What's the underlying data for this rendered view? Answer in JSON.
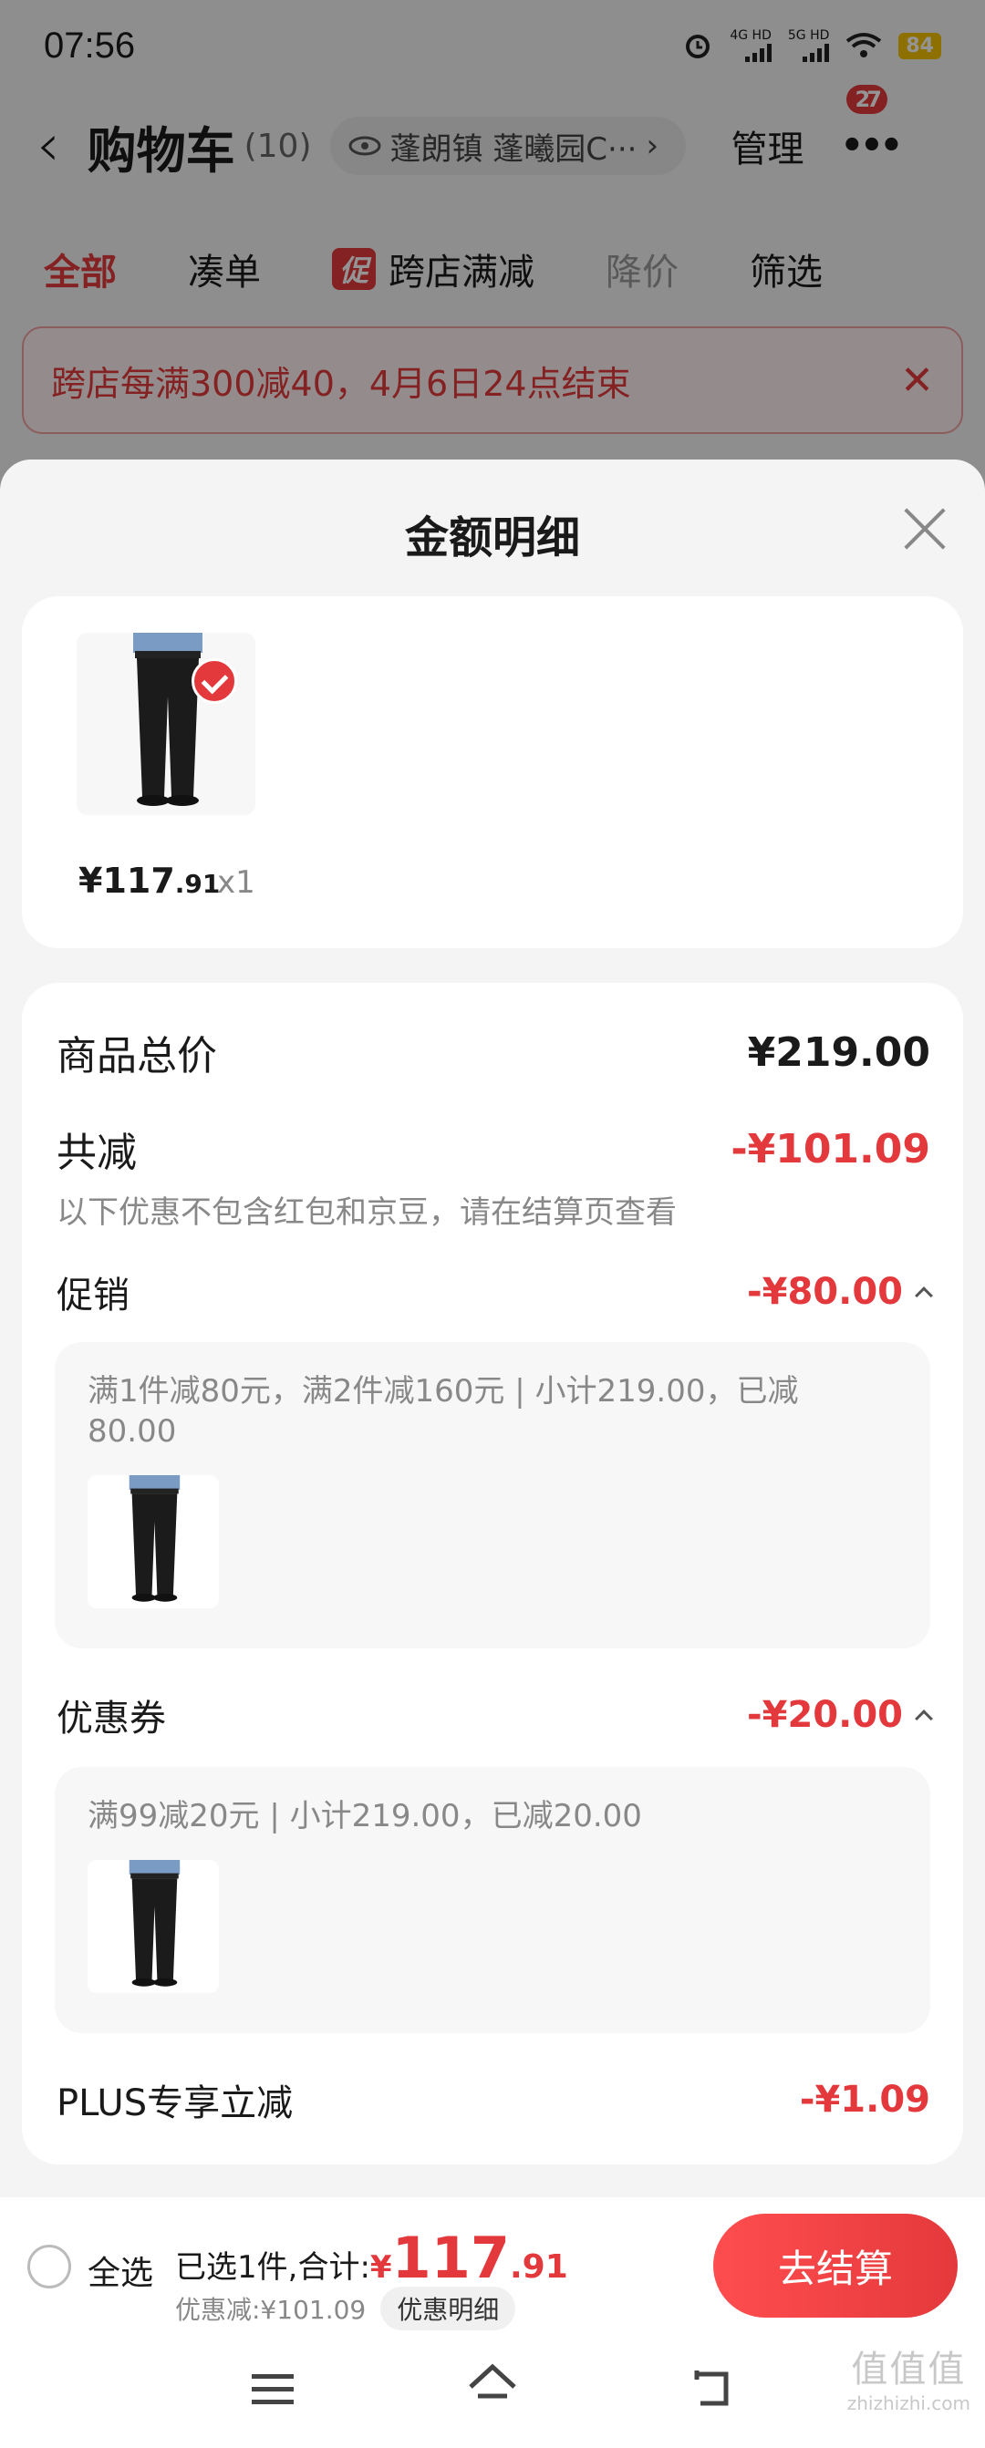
{
  "status_bar": {
    "time": "07:56",
    "net1": "4G HD",
    "net2": "5G HD",
    "battery": "84"
  },
  "header": {
    "title": "购物车",
    "count": "(10)",
    "address": "蓬朗镇 蓬曦园C···",
    "manage": "管理",
    "more_badge": "27"
  },
  "tabs": [
    {
      "label": "全部"
    },
    {
      "label": "凑单"
    },
    {
      "label": "跨店满减",
      "chip": "促"
    },
    {
      "label": "降价"
    },
    {
      "label": "筛选"
    }
  ],
  "banner": {
    "text": "跨店每满300减40，4月6日24点结束"
  },
  "sheet": {
    "title": "金额明细",
    "product": {
      "price_int": "¥117",
      "price_dec": ".91",
      "qty": "x1"
    },
    "total": {
      "label": "商品总价",
      "value": "¥219.00"
    },
    "reduce": {
      "label": "共减",
      "value": "-¥101.09",
      "note": "以下优惠不包含红包和京豆，请在结算页查看"
    },
    "promo": {
      "label": "促销",
      "value": "-¥80.00",
      "desc": "满1件减80元，满2件减160元 | 小计219.00，已减80.00"
    },
    "coupon": {
      "label": "优惠券",
      "value": "-¥20.00",
      "desc": "满99减20元 | 小计219.00，已减20.00"
    },
    "plus": {
      "label": "PLUS专享立减",
      "value": "-¥1.09"
    }
  },
  "bottom": {
    "select_all": "全选",
    "selected": "已选1件,合计:",
    "currency": "¥",
    "total_int": "117",
    "total_dec": ".91",
    "discount": "优惠减:¥101.09",
    "detail_btn": "优惠明细",
    "checkout": "去结算"
  },
  "watermark": {
    "big": "值值值",
    "small": "zhizhizhi.com"
  },
  "colors": {
    "accent": "#e4393c",
    "sheet_bg": "#f4f4f4",
    "card_bg": "#ffffff"
  },
  "icons": [
    "back-chevron-icon",
    "eye-icon",
    "more-dots-icon",
    "close-icon",
    "check-icon",
    "menu-icon",
    "home-icon",
    "back-icon"
  ]
}
